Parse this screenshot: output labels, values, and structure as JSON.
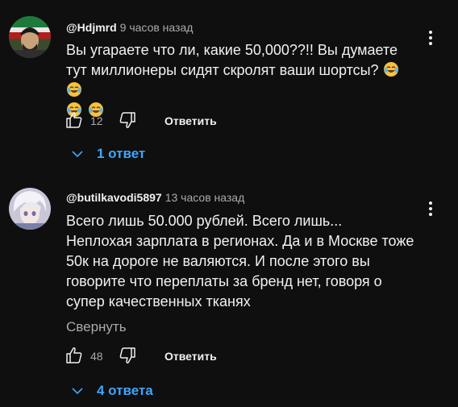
{
  "comments": [
    {
      "author": "@Hdjmrd",
      "time": "9 часов назад",
      "text": "Вы угараете что ли, какие 50,000??!! Вы думаете тут миллионеры сидят скролят ваши шортсы?",
      "emojis_inline": [
        "laughing-tears-emoji",
        "laughing-tears-emoji"
      ],
      "emojis_line2": [
        "laughing-tears-emoji",
        "laughing-tears-emoji"
      ],
      "likes": "12",
      "reply_label": "Ответить",
      "replies_label": "1 ответ"
    },
    {
      "author": "@butilkavodi5897",
      "time": "13 часов назад",
      "text_lines": [
        "Всего лишь 50.000 рублей. Всего лишь...",
        "Неплохая зарплата в регионах. Да и в Москве тоже",
        "50к на дороге не валяются. И после этого вы",
        "говорите что переплаты за бренд нет, говоря о",
        "супер качественных тканях"
      ],
      "collapse_label": "Свернуть",
      "likes": "48",
      "reply_label": "Ответить",
      "replies_label": "4 ответа"
    }
  ],
  "colors": {
    "background": "#0f0f0f",
    "text": "#f1f1f1",
    "secondary_text": "#aaaaaa",
    "link_blue": "#3ea6ff"
  }
}
